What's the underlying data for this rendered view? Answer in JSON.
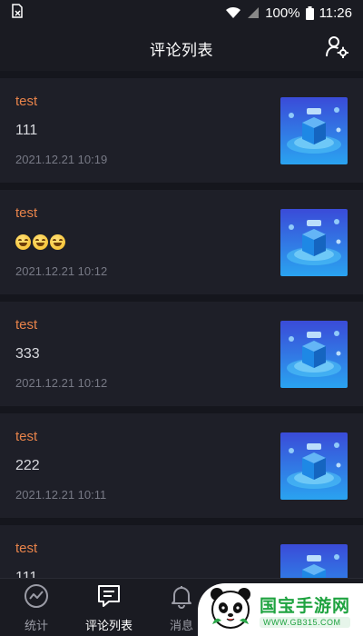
{
  "status_bar": {
    "battery": "100%",
    "time": "11:26"
  },
  "header": {
    "title": "评论列表"
  },
  "comments": [
    {
      "name": "test",
      "content": "111",
      "time": "2021.12.21 10:19"
    },
    {
      "name": "test",
      "content": "",
      "emoji_count": 3,
      "time": "2021.12.21 10:12"
    },
    {
      "name": "test",
      "content": "333",
      "time": "2021.12.21 10:12"
    },
    {
      "name": "test",
      "content": "222",
      "time": "2021.12.21 10:11"
    },
    {
      "name": "test",
      "content": "111",
      "time": ""
    }
  ],
  "bottom_nav": {
    "items": [
      {
        "label": "统计",
        "icon": "chart-line-icon",
        "active": false
      },
      {
        "label": "评论列表",
        "icon": "comment-icon",
        "active": true
      },
      {
        "label": "消息",
        "icon": "bell-icon",
        "active": false
      }
    ]
  },
  "watermark": {
    "title": "国宝手游网",
    "url": "WWW.GB315.COM"
  },
  "colors": {
    "background": "#15161d",
    "card": "#1e1f28",
    "accent_name": "#e8834a",
    "watermark_green": "#1fa340"
  }
}
